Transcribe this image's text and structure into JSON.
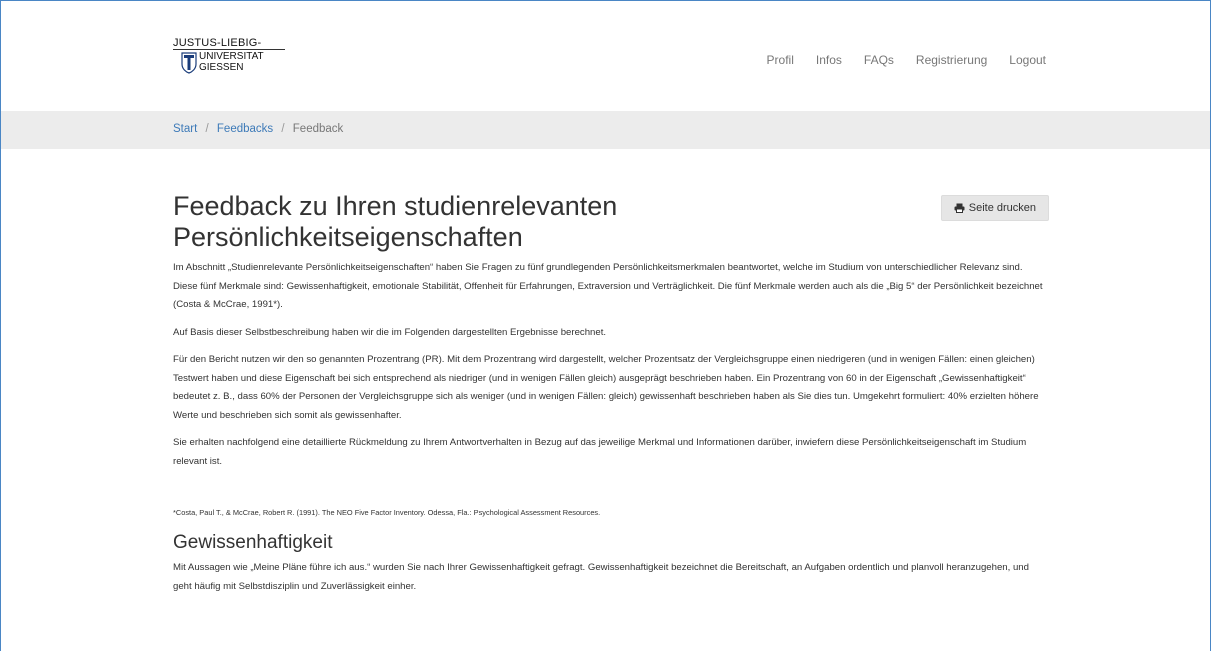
{
  "header": {
    "logo": {
      "line1": "JUSTUS-LIEBIG-",
      "line2": "UNIVERSITAT",
      "line3": "GIESSEN"
    },
    "nav": [
      "Profil",
      "Infos",
      "FAQs",
      "Registrierung",
      "Logout"
    ]
  },
  "breadcrumb": {
    "start": "Start",
    "feedbacks": "Feedbacks",
    "current": "Feedback",
    "separator": "/"
  },
  "main": {
    "title": "Feedback zu Ihren studienrelevanten Persönlichkeitseigenschaften",
    "print_label": "Seite drucken",
    "paragraphs": [
      "Im Abschnitt „Studienrelevante Persönlichkeitseigenschaften“ haben Sie Fragen zu fünf grundlegenden Persönlichkeitsmerkmalen beantwortet, welche im Studium von unterschiedlicher Relevanz sind. Diese fünf Merkmale sind: Gewissenhaftigkeit, emotionale Stabilität, Offenheit für Erfahrungen, Extraversion und Verträglichkeit. Die fünf Merkmale werden auch als die „Big 5“ der Persönlichkeit bezeichnet (Costa & McCrae, 1991*).",
      "Auf Basis dieser Selbstbeschreibung haben wir die im Folgenden dargestellten Ergebnisse berechnet.",
      "Für den Bericht nutzen wir den so genannten Prozentrang (PR). Mit dem Prozentrang wird dargestellt, welcher Prozentsatz der Vergleichsgruppe einen niedrigeren (und in wenigen Fällen: einen gleichen) Testwert haben und diese Eigenschaft bei sich entsprechend als niedriger (und in wenigen Fällen gleich) ausgeprägt beschrieben haben. Ein Prozentrang von 60 in der Eigenschaft „Gewissenhaftigkeit“ bedeutet z. B., dass 60% der Personen der Vergleichsgruppe sich als weniger (und in wenigen Fällen: gleich) gewissenhaft beschrieben haben als Sie dies tun. Umgekehrt formuliert: 40% erzielten höhere Werte und beschrieben sich somit als gewissenhafter.",
      "Sie erhalten nachfolgend eine detaillierte Rückmeldung zu Ihrem Antwortverhalten in Bezug auf das jeweilige Merkmal und Informationen darüber, inwiefern diese Persönlichkeitseigenschaft im Studium relevant ist."
    ],
    "footnote": "*Costa, Paul T., & McCrae, Robert R. (1991). The NEO Five Factor Inventory. Odessa, Fla.: Psychological Assessment Resources.",
    "section_title": "Gewissenhaftigkeit",
    "section_text": "Mit Aussagen wie „Meine Pläne führe ich aus.“ wurden Sie nach Ihrer Gewissenhaftigkeit gefragt. Gewissenhaftigkeit bezeichnet die Bereitschaft, an Aufgaben ordentlich und planvoll heranzugehen, und geht häufig mit Selbstdisziplin und Zuverlässigkeit einher."
  }
}
